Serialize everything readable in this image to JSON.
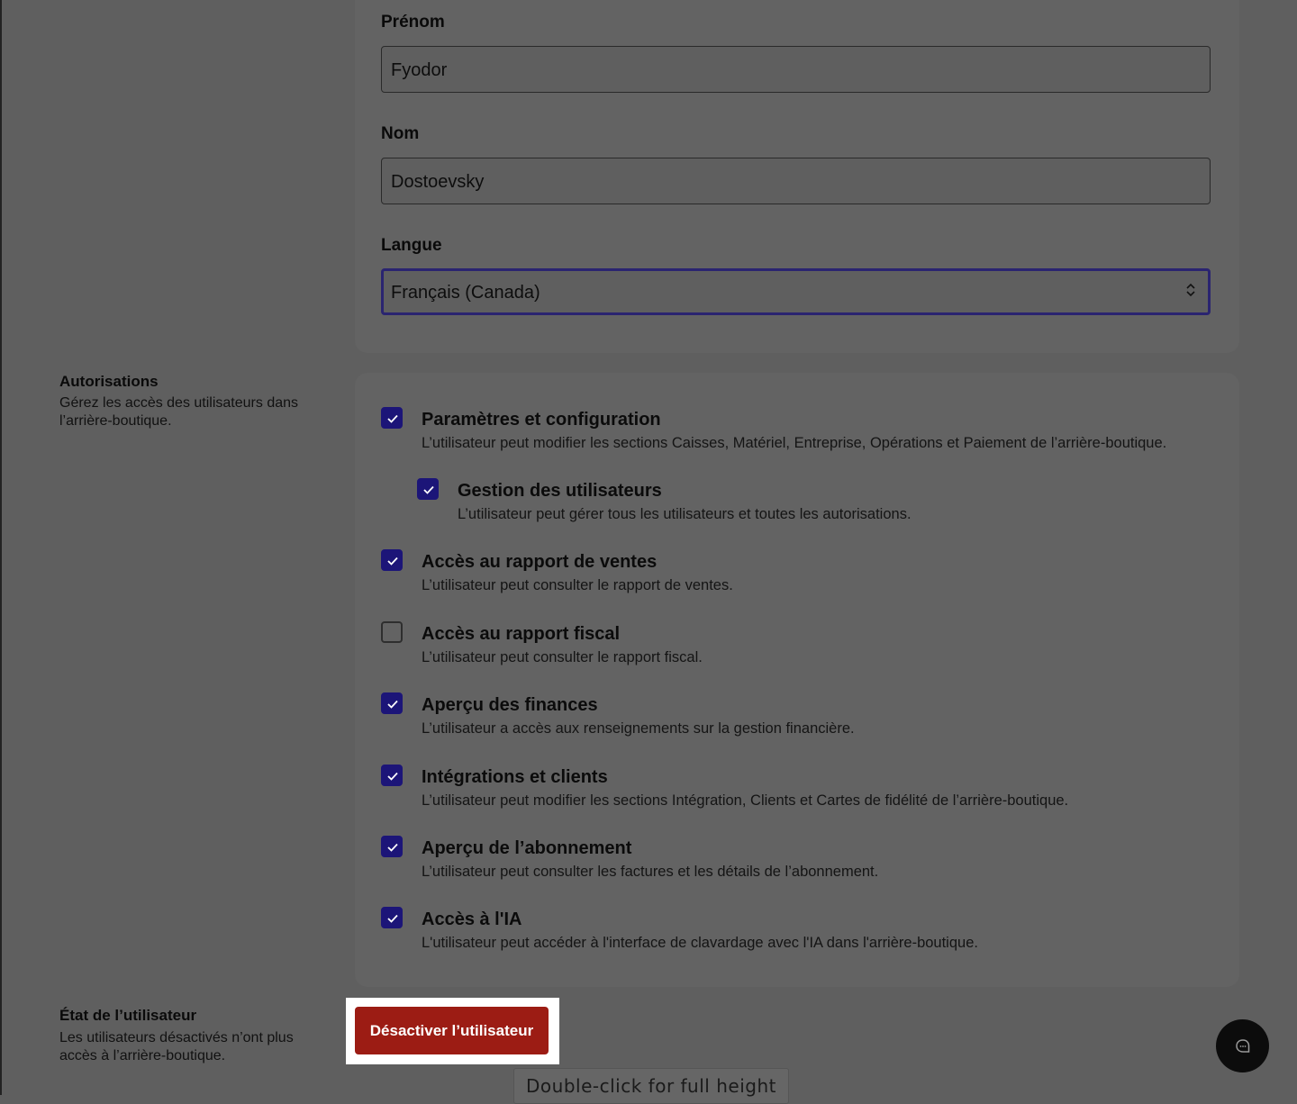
{
  "profile": {
    "first_name": {
      "label": "Prénom",
      "value": "Fyodor"
    },
    "last_name": {
      "label": "Nom",
      "value": "Dostoevsky"
    },
    "language": {
      "label": "Langue",
      "value": "Français (Canada)",
      "icon": "chevron-up-down-icon"
    }
  },
  "permissions": {
    "title": "Autorisations",
    "description": "Gérez les accès des utilisateurs dans l’arrière-boutique.",
    "items": [
      {
        "title": "Paramètres et configuration",
        "description": "L’utilisateur peut modifier les sections Caisses, Matériel, Entreprise, Opérations et Paiement de l’arrière-boutique.",
        "checked": true
      },
      {
        "title": "Gestion des utilisateurs",
        "description": "L’utilisateur peut gérer tous les utilisateurs et toutes les autorisations.",
        "checked": true
      },
      {
        "title": "Accès au rapport de ventes",
        "description": "L’utilisateur peut consulter le rapport de ventes.",
        "checked": true
      },
      {
        "title": "Accès au rapport fiscal",
        "description": "L’utilisateur peut consulter le rapport fiscal.",
        "checked": false
      },
      {
        "title": "Aperçu des finances",
        "description": "L’utilisateur a accès aux renseignements sur la gestion financière.",
        "checked": true
      },
      {
        "title": "Intégrations et clients",
        "description": "L’utilisateur peut modifier les sections Intégration, Clients et Cartes de fidélité de l’arrière-boutique.",
        "checked": true
      },
      {
        "title": "Aperçu de l’abonnement",
        "description": "L’utilisateur peut consulter les factures et les détails de l’abonnement.",
        "checked": true
      },
      {
        "title": "Accès à l'IA",
        "description": "L'utilisateur peut accéder à l'interface de clavardage avec l'IA dans l'arrière-boutique.",
        "checked": true
      }
    ]
  },
  "user_state": {
    "title": "État de l’utilisateur",
    "description": "Les utilisateurs désactivés n’ont plus accès à l’arrière-boutique.",
    "deactivate_label": "Désactiver l’utilisateur"
  },
  "chat": {
    "icon": "chat-bubble-icon"
  },
  "tooltip": {
    "text": "Double-click for full height"
  },
  "colors": {
    "checkbox": "#1c1578",
    "danger_button": "#9c1c14",
    "overlay_background": "#5f5f5f"
  }
}
